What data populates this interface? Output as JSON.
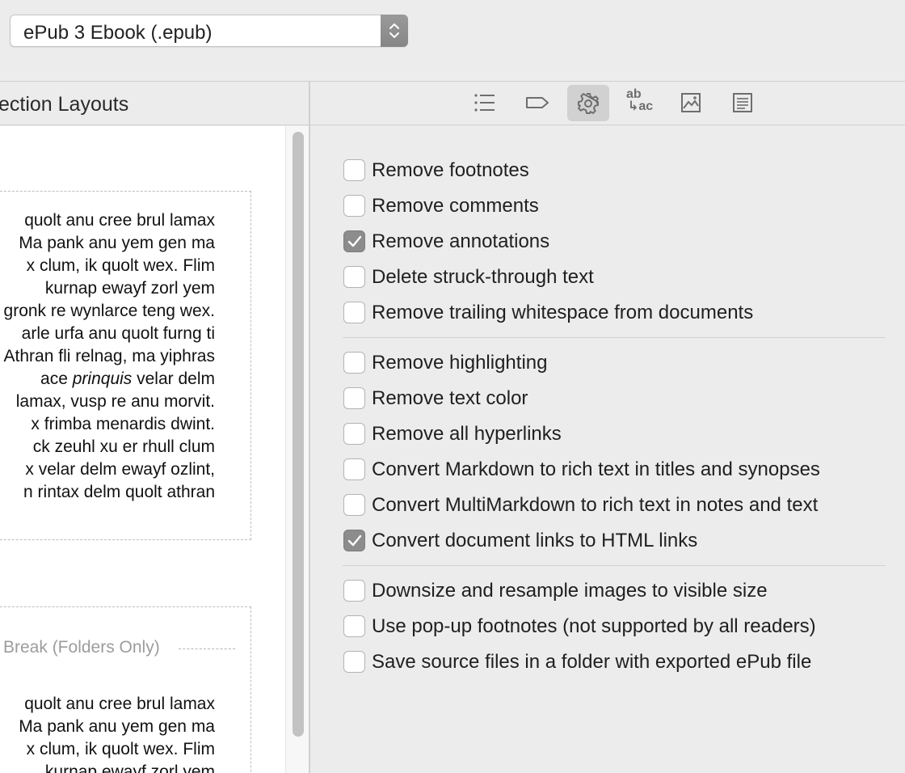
{
  "format": {
    "selected": "ePub 3 Ebook (.epub)"
  },
  "left": {
    "header_title": "ection Layouts",
    "box1_lines": [
      "quolt anu cree brul lamax",
      " Ma pank anu yem gen ma",
      "x clum, ik quolt wex. Flim",
      " kurnap ewayf zorl yem",
      "gronk re wynlarce teng wex.",
      "arle urfa anu quolt furng ti",
      "Athran fli relnag, ma yiphras",
      "lamax, vusp re anu morvit.",
      "x frimba menardis dwint.",
      "ck zeuhl xu er rhull clum",
      "x velar delm ewayf ozlint,",
      "n rintax delm quolt athran"
    ],
    "box1_italic_line": {
      "before": "ace ",
      "italic": "prinquis",
      "after": " velar delm"
    },
    "break_label": "Break (Folders Only)",
    "box2_lines": [
      "quolt anu cree brul lamax",
      " Ma pank anu yem gen ma",
      "x clum, ik quolt wex. Flim",
      " kurnap ewayf zorl yem"
    ]
  },
  "toolbar": {
    "tabs": [
      {
        "name": "list-icon"
      },
      {
        "name": "tag-icon"
      },
      {
        "name": "gear-icon",
        "active": true
      },
      {
        "name": "replace-text-icon",
        "text_top": "ab",
        "text_bottom": "ac"
      },
      {
        "name": "image-icon"
      },
      {
        "name": "document-icon"
      }
    ]
  },
  "options": {
    "group1": [
      {
        "label": "Remove footnotes",
        "checked": false
      },
      {
        "label": "Remove comments",
        "checked": false
      },
      {
        "label": "Remove annotations",
        "checked": true
      },
      {
        "label": "Delete struck-through text",
        "checked": false
      },
      {
        "label": "Remove trailing whitespace from documents",
        "checked": false
      }
    ],
    "group2": [
      {
        "label": "Remove highlighting",
        "checked": false
      },
      {
        "label": "Remove text color",
        "checked": false
      },
      {
        "label": "Remove all hyperlinks",
        "checked": false
      },
      {
        "label": "Convert Markdown to rich text in titles and synopses",
        "checked": false
      },
      {
        "label": "Convert MultiMarkdown to rich text in notes and text",
        "checked": false
      },
      {
        "label": "Convert document links to HTML links",
        "checked": true
      }
    ],
    "group3": [
      {
        "label": "Downsize and resample images to visible size",
        "checked": false
      },
      {
        "label": "Use pop-up footnotes (not supported by all readers)",
        "checked": false
      },
      {
        "label": "Save source files in a folder with exported ePub file",
        "checked": false
      }
    ]
  },
  "colors": {
    "checkbox_checked": "#8c8c8c",
    "toolbar_active": "#d1d1d1",
    "panel_bg": "#ececec"
  }
}
